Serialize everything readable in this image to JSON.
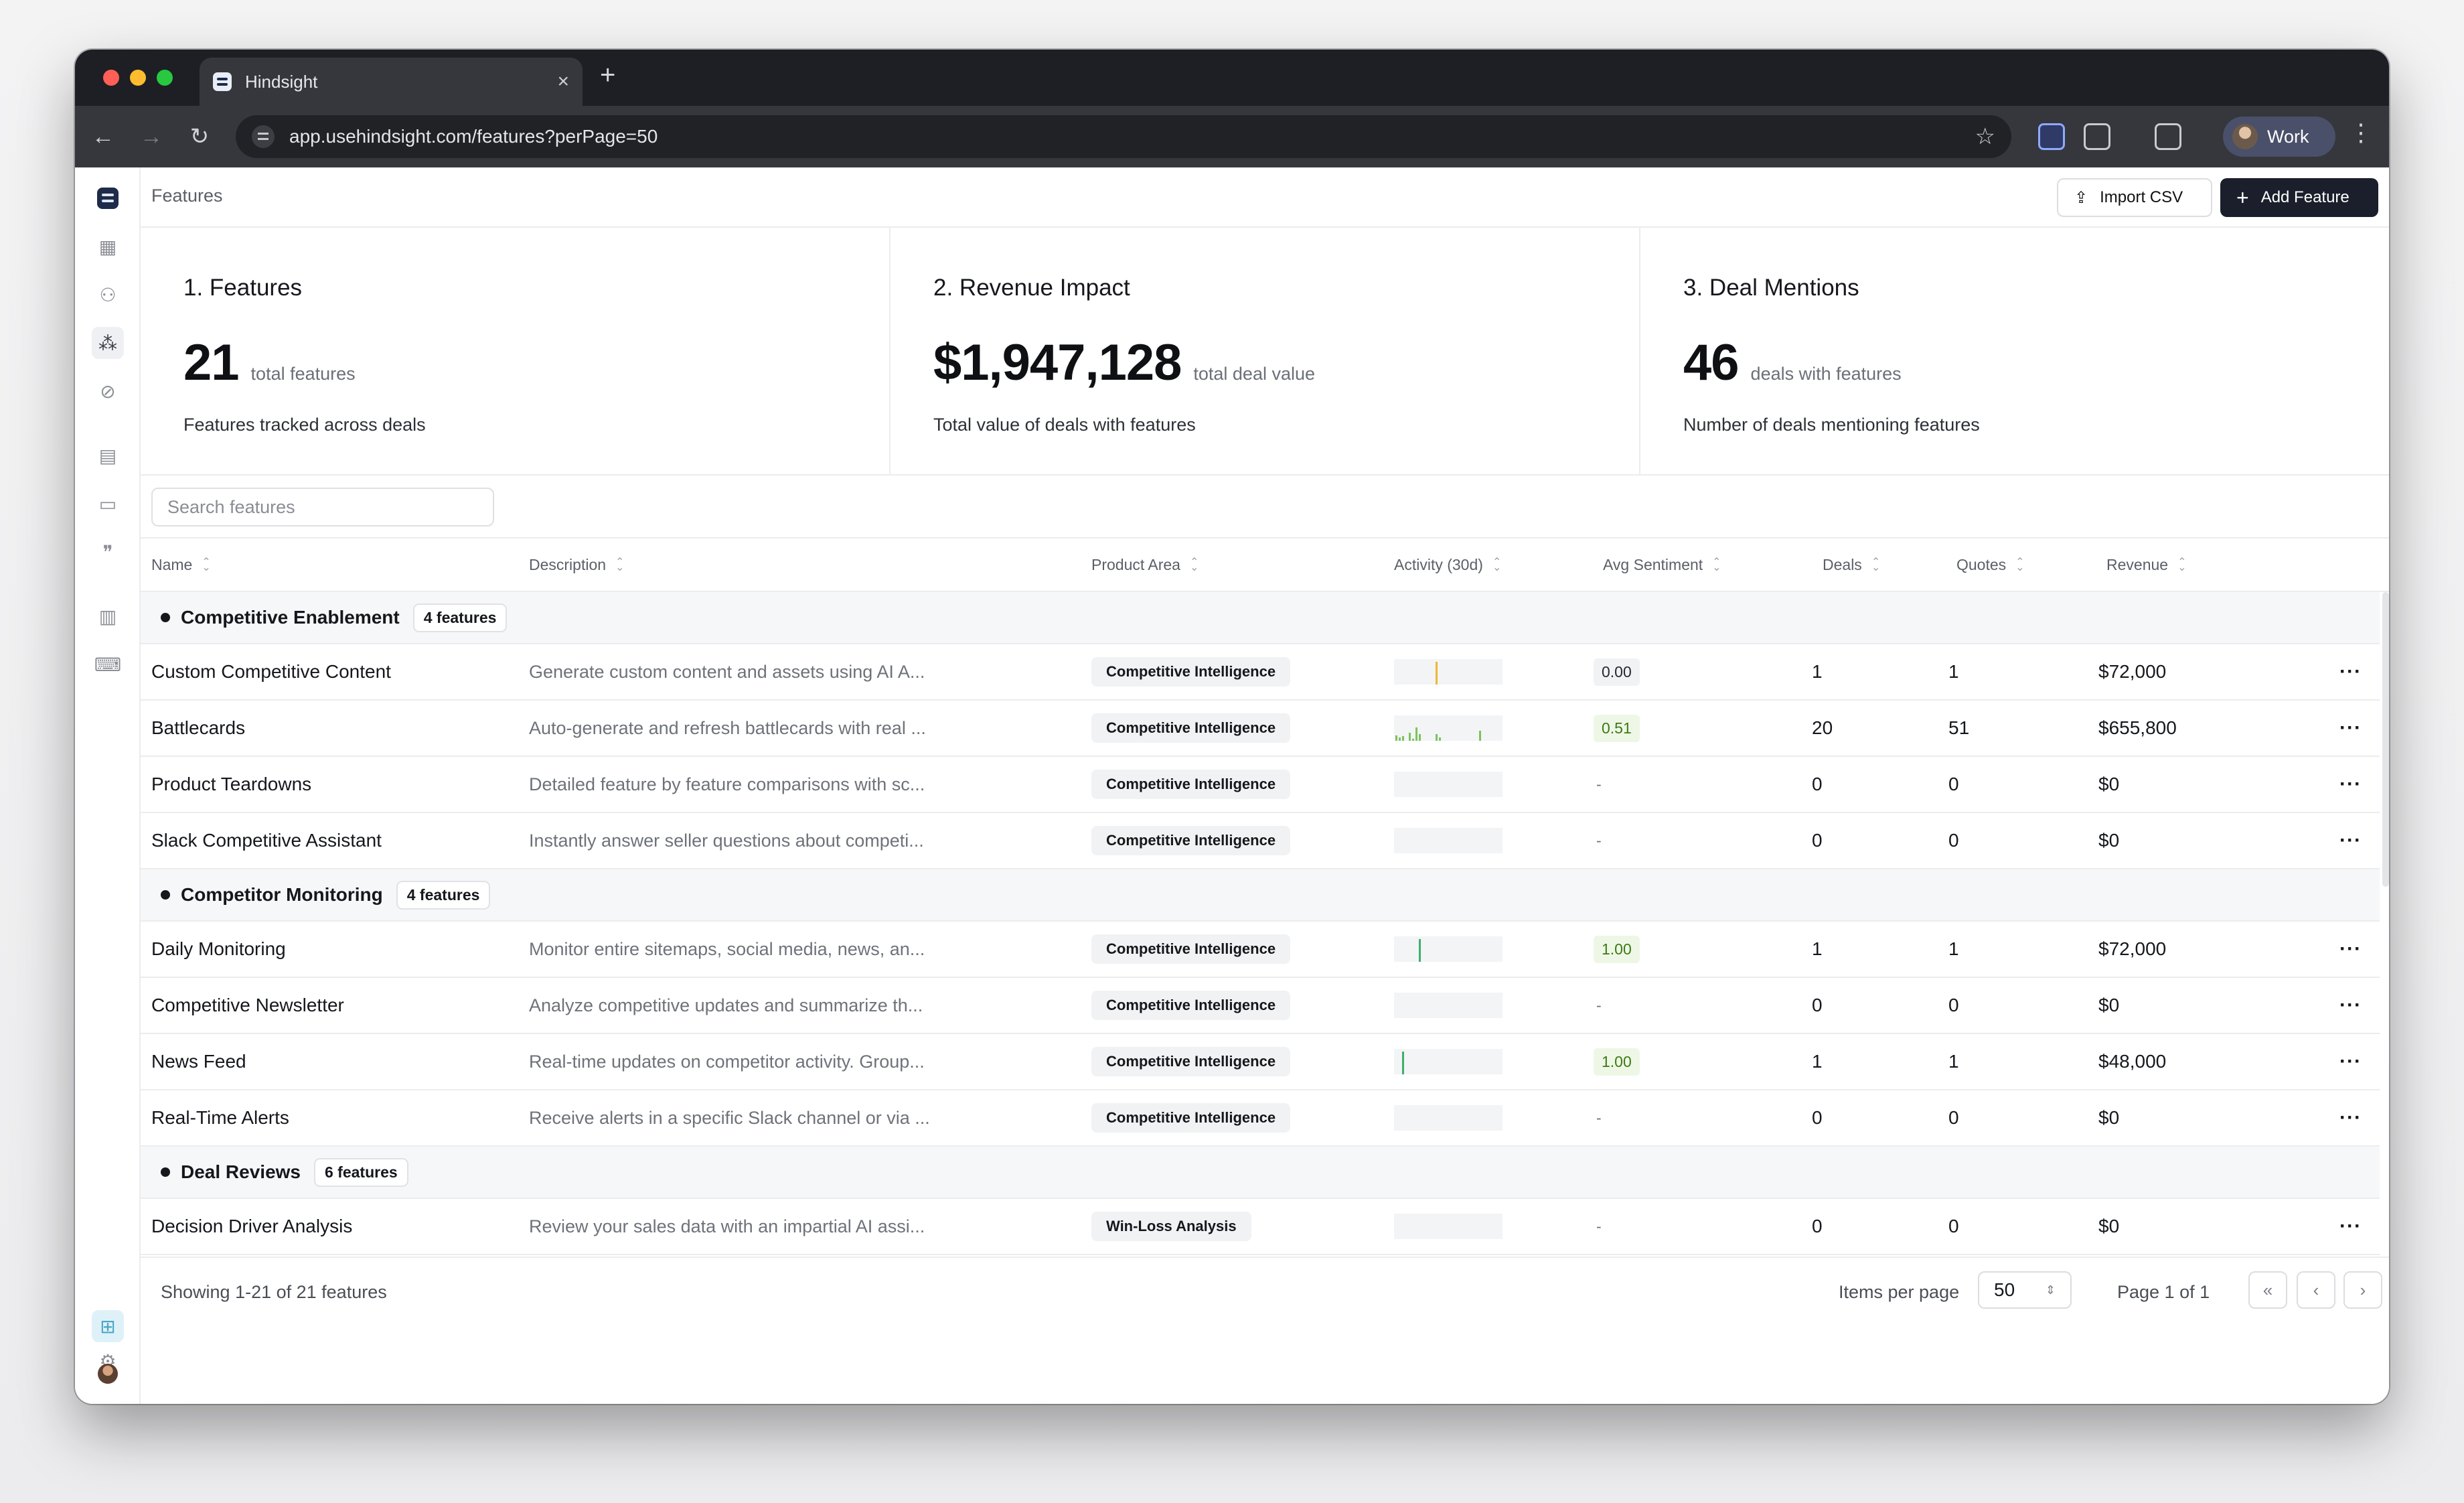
{
  "browser": {
    "tab_title": "Hindsight",
    "url": "app.usehindsight.com/features?perPage=50",
    "profile_label": "Work",
    "traffic_colors": [
      "#ff5f57",
      "#febc2e",
      "#28c840"
    ]
  },
  "header": {
    "breadcrumb": "Features",
    "import_label": "Import CSV",
    "add_label": "Add Feature"
  },
  "stats": [
    {
      "title": "1. Features",
      "value": "21",
      "unit": "total features",
      "desc": "Features tracked across deals"
    },
    {
      "title": "2. Revenue Impact",
      "value": "$1,947,128",
      "unit": "total deal value",
      "desc": "Total value of deals with features"
    },
    {
      "title": "3. Deal Mentions",
      "value": "46",
      "unit": "deals with features",
      "desc": "Number of deals mentioning features"
    }
  ],
  "search": {
    "placeholder": "Search features"
  },
  "columns": {
    "name": "Name",
    "description": "Description",
    "area": "Product Area",
    "activity": "Activity (30d)",
    "sentiment": "Avg Sentiment",
    "deals": "Deals",
    "quotes": "Quotes",
    "revenue": "Revenue"
  },
  "groups": [
    {
      "name": "Competitive Enablement",
      "count": "4 features",
      "rows": [
        {
          "name": "Custom Competitive Content",
          "desc": "Generate custom content and assets using AI A...",
          "area": "Competitive Intelligence",
          "spark": [
            0,
            0,
            0,
            0,
            0,
            0,
            0,
            0,
            0,
            0,
            0,
            0,
            1,
            0,
            0,
            0,
            0,
            0,
            0,
            0,
            0,
            0,
            0,
            0,
            0,
            0,
            0,
            0,
            0,
            0
          ],
          "spark_color": "#f2b631",
          "sentiment": "0.00",
          "sentiment_tone": "neutral",
          "deals": "1",
          "quotes": "1",
          "revenue": "$72,000"
        },
        {
          "name": "Battlecards",
          "desc": "Auto-generate and refresh battlecards with real ...",
          "area": "Competitive Intelligence",
          "spark": [
            0.25,
            0.15,
            0.2,
            0,
            0.35,
            0.1,
            0.6,
            0.3,
            0,
            0,
            0,
            0,
            0.3,
            0.15,
            0,
            0,
            0,
            0,
            0,
            0,
            0,
            0,
            0,
            0,
            0,
            0.45,
            0,
            0,
            0,
            0
          ],
          "spark_color": "#7cc35a",
          "sentiment": "0.51",
          "sentiment_tone": "positive",
          "deals": "20",
          "quotes": "51",
          "revenue": "$655,800"
        },
        {
          "name": "Product Teardowns",
          "desc": "Detailed feature by feature comparisons with sc...",
          "area": "Competitive Intelligence",
          "spark": [],
          "spark_color": "#7cc35a",
          "sentiment": "-",
          "sentiment_tone": "none",
          "deals": "0",
          "quotes": "0",
          "revenue": "$0"
        },
        {
          "name": "Slack Competitive Assistant",
          "desc": "Instantly answer seller questions about competi...",
          "area": "Competitive Intelligence",
          "spark": [],
          "spark_color": "#7cc35a",
          "sentiment": "-",
          "sentiment_tone": "none",
          "deals": "0",
          "quotes": "0",
          "revenue": "$0"
        }
      ]
    },
    {
      "name": "Competitor Monitoring",
      "count": "4 features",
      "rows": [
        {
          "name": "Daily Monitoring",
          "desc": "Monitor entire sitemaps, social media, news, an...",
          "area": "Competitive Intelligence",
          "spark": [
            0,
            0,
            0,
            0,
            0,
            0,
            0,
            1,
            0,
            0,
            0,
            0,
            0,
            0,
            0,
            0,
            0,
            0,
            0,
            0,
            0,
            0,
            0,
            0,
            0,
            0,
            0,
            0,
            0,
            0
          ],
          "spark_color": "#3bb06a",
          "sentiment": "1.00",
          "sentiment_tone": "positive",
          "deals": "1",
          "quotes": "1",
          "revenue": "$72,000"
        },
        {
          "name": "Competitive Newsletter",
          "desc": "Analyze competitive updates and summarize th...",
          "area": "Competitive Intelligence",
          "spark": [],
          "spark_color": "#3bb06a",
          "sentiment": "-",
          "sentiment_tone": "none",
          "deals": "0",
          "quotes": "0",
          "revenue": "$0"
        },
        {
          "name": "News Feed",
          "desc": "Real-time updates on competitor activity. Group...",
          "area": "Competitive Intelligence",
          "spark": [
            0,
            0,
            1,
            0,
            0,
            0,
            0,
            0,
            0,
            0,
            0,
            0,
            0,
            0,
            0,
            0,
            0,
            0,
            0,
            0,
            0,
            0,
            0,
            0,
            0,
            0,
            0,
            0,
            0,
            0
          ],
          "spark_color": "#3bb06a",
          "sentiment": "1.00",
          "sentiment_tone": "positive",
          "deals": "1",
          "quotes": "1",
          "revenue": "$48,000"
        },
        {
          "name": "Real-Time Alerts",
          "desc": "Receive alerts in a specific Slack channel or via ...",
          "area": "Competitive Intelligence",
          "spark": [],
          "spark_color": "#3bb06a",
          "sentiment": "-",
          "sentiment_tone": "none",
          "deals": "0",
          "quotes": "0",
          "revenue": "$0"
        }
      ]
    },
    {
      "name": "Deal Reviews",
      "count": "6 features",
      "rows": [
        {
          "name": "Decision Driver Analysis",
          "desc": "Review your sales data with an impartial AI assi...",
          "area": "Win-Loss Analysis",
          "spark": [],
          "spark_color": "#3bb06a",
          "sentiment": "-",
          "sentiment_tone": "none",
          "deals": "0",
          "quotes": "0",
          "revenue": "$0"
        }
      ]
    }
  ],
  "footer": {
    "showing": "Showing 1-21 of 21 features",
    "items_per_page_label": "Items per page",
    "items_per_page_value": "50",
    "page_label": "Page 1 of 1"
  },
  "icons": {
    "rail": [
      "dashboard-icon",
      "users-icon",
      "features-icon",
      "competitors-icon",
      "layout-icon",
      "chat-icon",
      "quotes-icon",
      "reports-icon",
      "messages-icon",
      "gift-icon",
      "settings-icon"
    ],
    "pagination": [
      "first-page-icon",
      "prev-page-icon",
      "next-page-icon",
      "last-page-icon"
    ]
  }
}
